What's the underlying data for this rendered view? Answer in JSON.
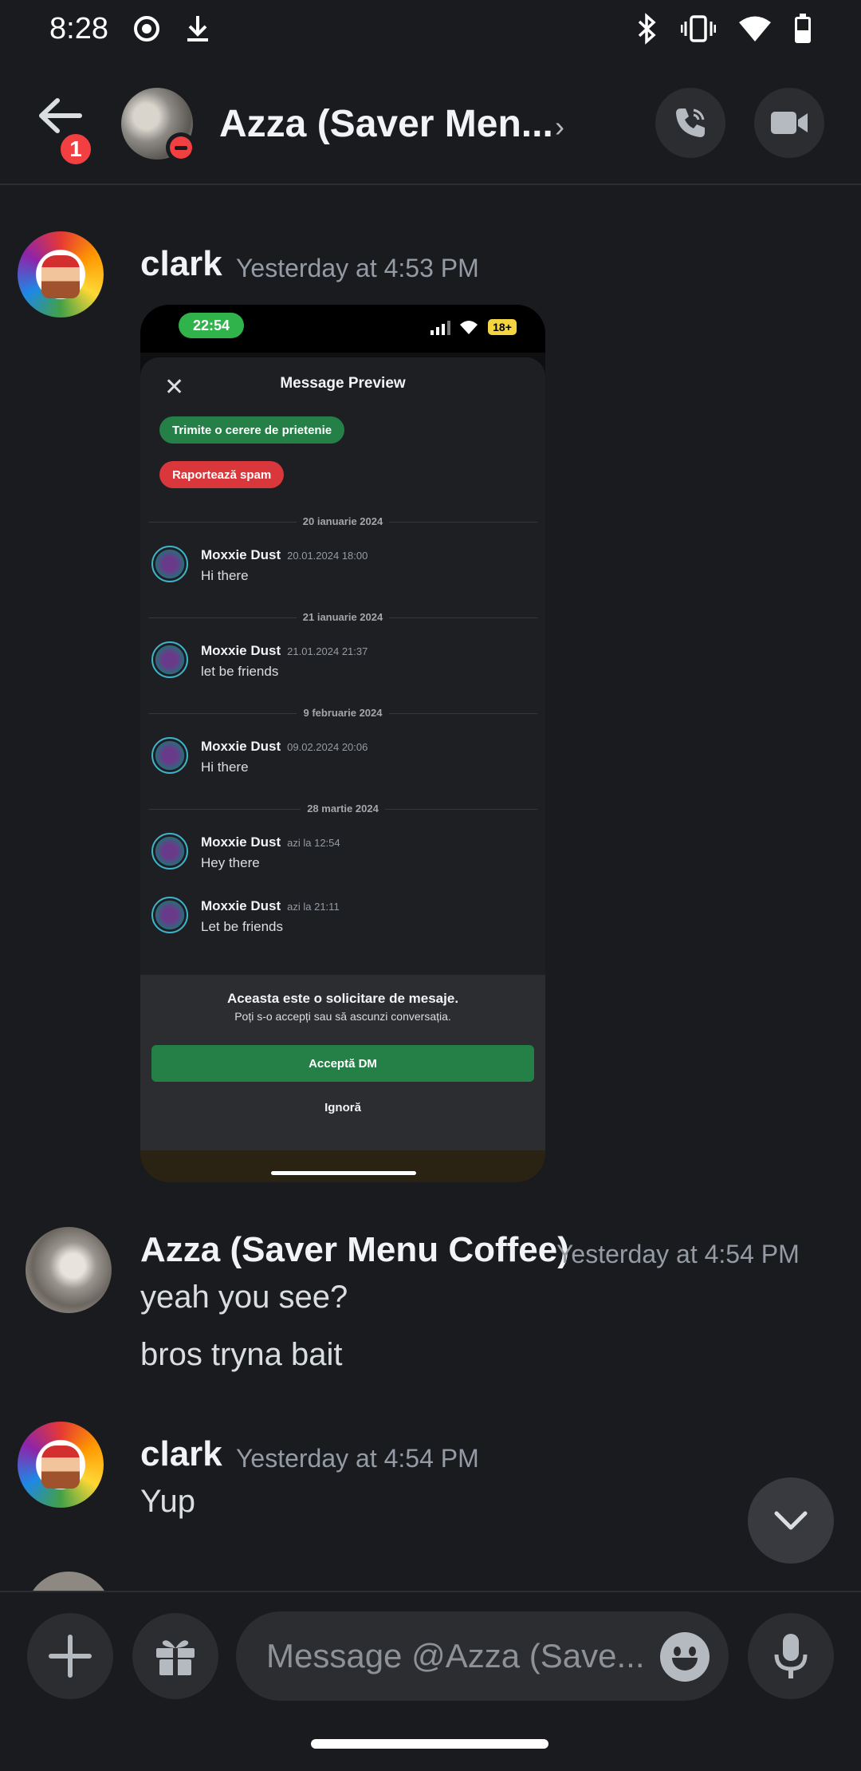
{
  "status_bar": {
    "time": "8:28"
  },
  "header": {
    "title": "Azza (Saver Men...",
    "unread_count": "1"
  },
  "messages": [
    {
      "author": "clark",
      "time": "Yesterday at 4:53 PM"
    },
    {
      "author": "Azza (Saver Menu Coffee)",
      "time": "Yesterday at 4:54 PM",
      "lines": [
        "yeah you see?",
        "bros tryna bait"
      ]
    },
    {
      "author": "clark",
      "time": "Yesterday at 4:54 PM",
      "lines": [
        "Yup"
      ]
    }
  ],
  "embed": {
    "phone_time": "22:54",
    "battery": "18+",
    "title": "Message Preview",
    "add_friend": "Trimite o cerere de prietenie",
    "report_spam": "Raportează spam",
    "groups": [
      {
        "date": "20 ianuarie 2024",
        "msgs": [
          {
            "name": "Moxxie Dust",
            "time": "20.01.2024 18:00",
            "text": "Hi there"
          }
        ]
      },
      {
        "date": "21 ianuarie 2024",
        "msgs": [
          {
            "name": "Moxxie Dust",
            "time": "21.01.2024 21:37",
            "text": "let be friends"
          }
        ]
      },
      {
        "date": "9 februarie 2024",
        "msgs": [
          {
            "name": "Moxxie Dust",
            "time": "09.02.2024 20:06",
            "text": "Hi there"
          }
        ]
      },
      {
        "date": "28 martie 2024",
        "msgs": [
          {
            "name": "Moxxie Dust",
            "time": "azi la 12:54",
            "text": "Hey there"
          },
          {
            "name": "Moxxie Dust",
            "time": "azi la 21:11",
            "text": "Let be friends"
          }
        ]
      }
    ],
    "request_title": "Aceasta este o solicitare de mesaje.",
    "request_sub": "Poți s-o accepți sau să ascunzi conversația.",
    "accept": "Acceptă DM",
    "ignore": "Ignoră"
  },
  "composer": {
    "placeholder": "Message @Azza (Save..."
  },
  "colors": {
    "accent_green": "#248046",
    "danger_red": "#f23f42",
    "background": "#1a1b1f"
  }
}
